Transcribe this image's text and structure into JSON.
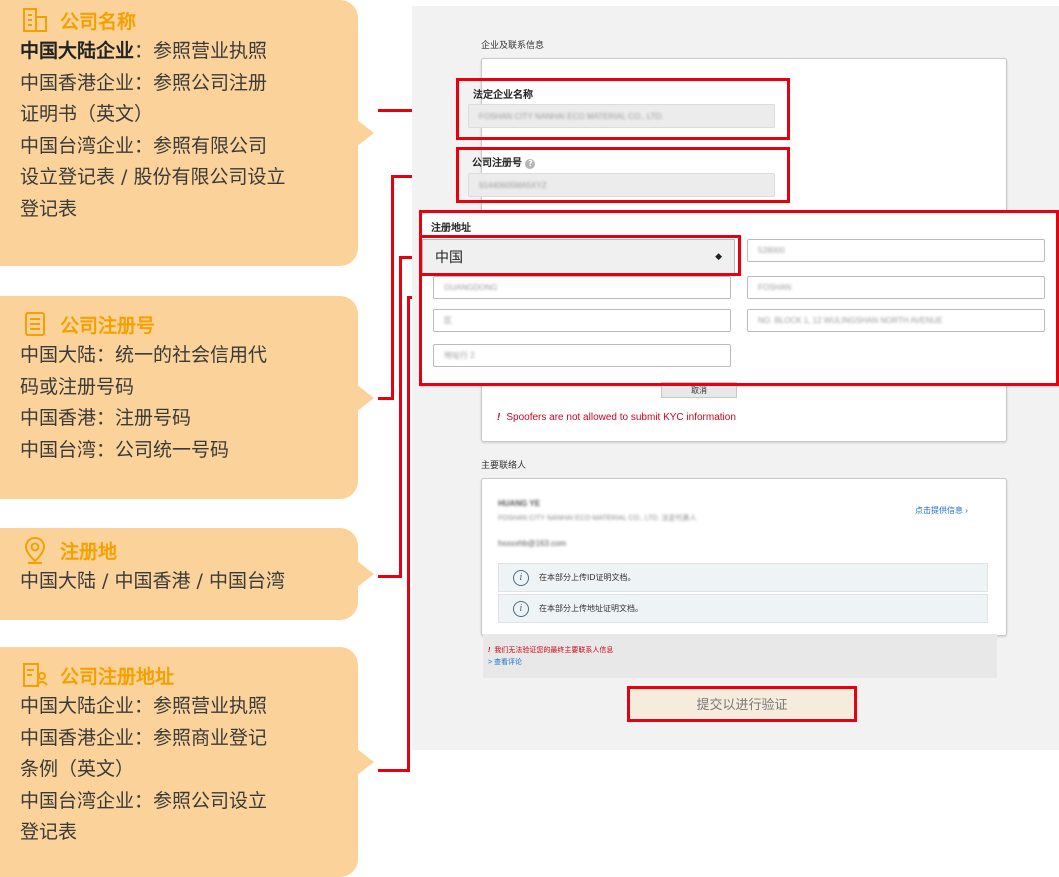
{
  "callouts": [
    {
      "title": "公司名称",
      "icon": "building-icon",
      "lines": [
        {
          "bold": "中国大陆企业",
          "rest": "：参照营业执照"
        },
        {
          "bold": "",
          "rest": "中国香港企业：参照公司注册"
        },
        {
          "bold": "",
          "rest": "证明书（英文）"
        },
        {
          "bold": "",
          "rest": "中国台湾企业：参照有限公司"
        },
        {
          "bold": "",
          "rest": "设立登记表 / 股份有限公司设立"
        },
        {
          "bold": "",
          "rest": "登记表"
        }
      ]
    },
    {
      "title": "公司注册号",
      "icon": "document-icon",
      "lines": [
        "中国大陆：统一的社会信用代",
        "码或注册号码",
        "中国香港：注册号码",
        "中国台湾：公司统一号码"
      ]
    },
    {
      "title": "注册地",
      "icon": "location-pin-icon",
      "lines": [
        "中国大陆 / 中国香港 / 中国台湾"
      ]
    },
    {
      "title": "公司注册地址",
      "icon": "address-doc-icon",
      "lines": [
        "中国大陆企业：参照营业执照",
        "中国香港企业：参照商业登记",
        "条例（英文）",
        "中国台湾企业：参照公司设立",
        "登记表"
      ]
    }
  ],
  "form": {
    "section1_label": "企业及联系信息",
    "legal_name_label": "法定企业名称",
    "legal_name_value": "FOSHAN CITY NANHAI ECO MATERIAL CO., LTD.",
    "reg_no_label": "公司注册号",
    "reg_no_value": "91440605MA5XYZ",
    "address_label": "注册地址",
    "country_select": "中国",
    "addr_fields": [
      "528000",
      "GUANGDONG",
      "FOSHAN",
      "区",
      "NO. BLOCK 1, 12 WULINGSHAN NORTH AVENUE",
      "地址行 2"
    ],
    "cancel_label": "取消",
    "spoofer_warning": "Spoofers are not allowed to submit KYC information",
    "section2_label": "主要联络人",
    "contact_name": "HUANG YE",
    "contact_company": "FOSHAN CITY NANHAI ECO MATERIAL CO., LTD. 法定代表人",
    "contact_email": "hxxxxhb@163.com",
    "provide_info_link": "点击提供信息 ›",
    "info_rows": [
      "在本部分上传ID证明文档。",
      "在本部分上传地址证明文档。"
    ],
    "error_note": "我们无法验证您的最终主要联系人信息",
    "view_review_link": "> 查看评论",
    "submit_label": "提交以进行验证"
  },
  "colors": {
    "callout_bg": "#fbd39a",
    "callout_title": "#f5a000",
    "highlight_red": "#e8000f",
    "link_blue": "#1a6fc9"
  }
}
